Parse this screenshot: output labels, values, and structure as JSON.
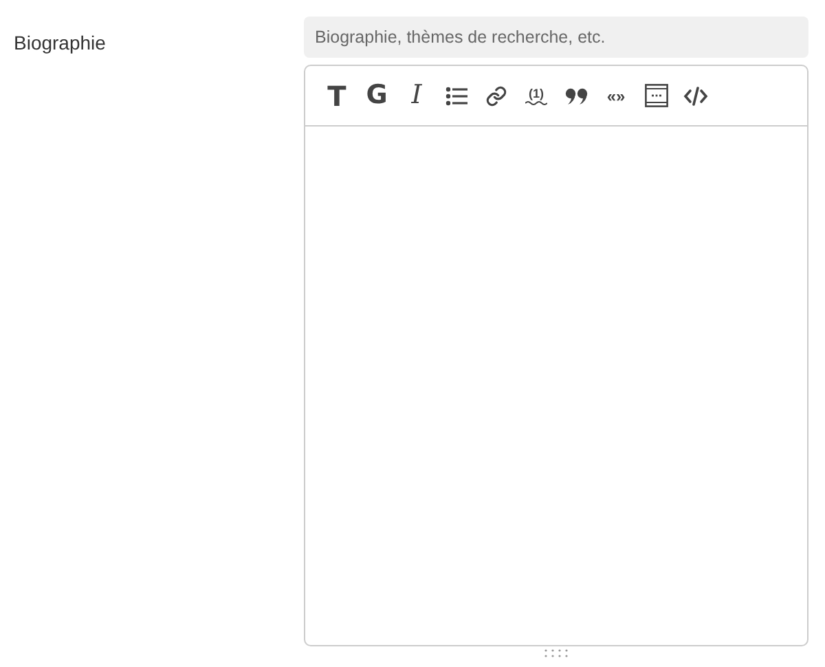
{
  "field": {
    "label": "Biographie",
    "help": "Biographie, thèmes de recherche, etc."
  },
  "toolbar": [
    {
      "kind": "bold",
      "label": "T"
    },
    {
      "kind": "heavy",
      "label": "G"
    },
    {
      "kind": "italic",
      "label": "I"
    },
    {
      "kind": "list"
    },
    {
      "kind": "link"
    },
    {
      "kind": "note",
      "label": "(1)"
    },
    {
      "kind": "quote"
    },
    {
      "kind": "small",
      "label": "«»"
    },
    {
      "kind": "frame"
    },
    {
      "kind": "code"
    }
  ]
}
